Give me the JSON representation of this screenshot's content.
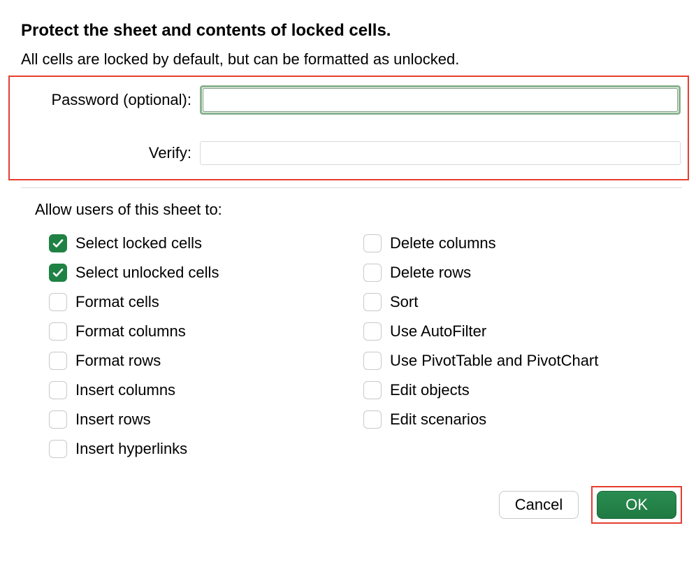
{
  "title": "Protect the sheet and contents of locked cells.",
  "subtitle": "All cells are locked by default, but can be formatted as unlocked.",
  "password": {
    "label": "Password (optional):",
    "value": ""
  },
  "verify": {
    "label": "Verify:",
    "value": ""
  },
  "allow_label": "Allow users of this sheet to:",
  "permissions_left": [
    {
      "label": "Select locked cells",
      "checked": true
    },
    {
      "label": "Select unlocked cells",
      "checked": true
    },
    {
      "label": "Format cells",
      "checked": false
    },
    {
      "label": "Format columns",
      "checked": false
    },
    {
      "label": "Format rows",
      "checked": false
    },
    {
      "label": "Insert columns",
      "checked": false
    },
    {
      "label": "Insert rows",
      "checked": false
    },
    {
      "label": "Insert hyperlinks",
      "checked": false
    }
  ],
  "permissions_right": [
    {
      "label": "Delete columns",
      "checked": false
    },
    {
      "label": "Delete rows",
      "checked": false
    },
    {
      "label": "Sort",
      "checked": false
    },
    {
      "label": "Use AutoFilter",
      "checked": false
    },
    {
      "label": "Use PivotTable and PivotChart",
      "checked": false
    },
    {
      "label": "Edit objects",
      "checked": false
    },
    {
      "label": "Edit scenarios",
      "checked": false
    }
  ],
  "buttons": {
    "cancel": "Cancel",
    "ok": "OK"
  }
}
